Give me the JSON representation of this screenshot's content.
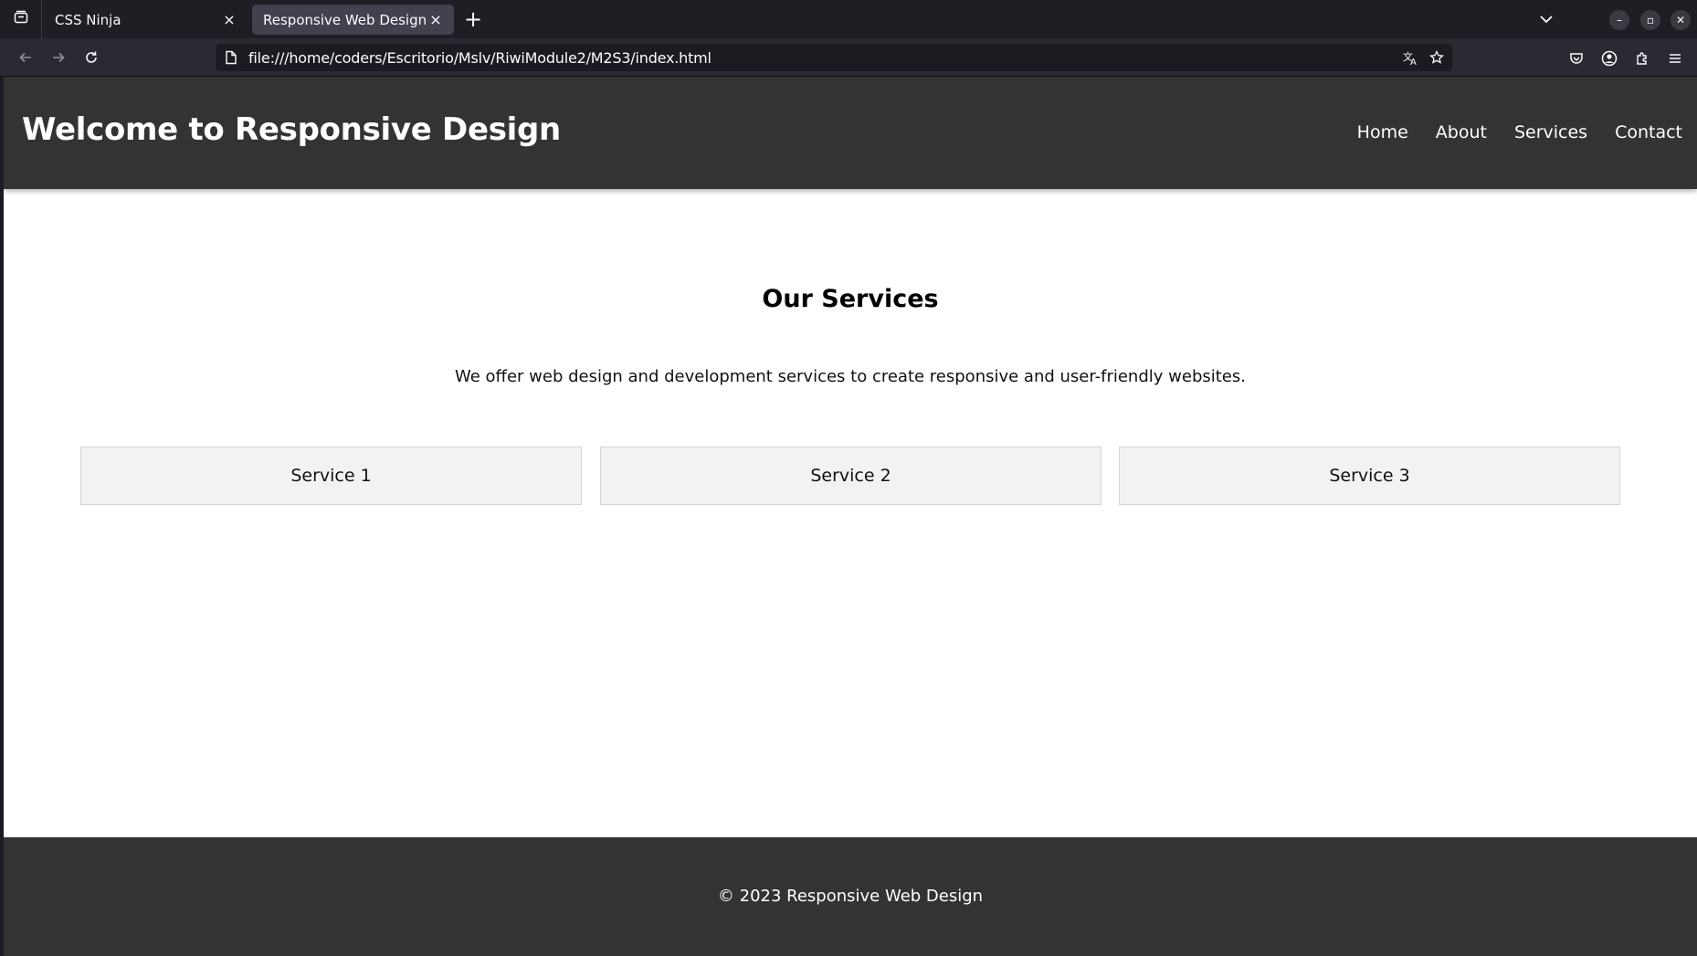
{
  "browser": {
    "tabs": [
      {
        "label": "CSS Ninja",
        "close": "×"
      },
      {
        "label": "Responsive Web Design",
        "close": "×"
      }
    ],
    "new_tab": "+",
    "window_controls": {
      "minimize": "–",
      "maximize": "▫",
      "close": "✕"
    },
    "url": "file:///home/coders/Escritorio/Mslv/RiwiModule2/M2S3/index.html",
    "icons": [
      "tab-list-icon",
      "back-arrow-icon",
      "forward-arrow-icon",
      "reload-icon",
      "page-icon",
      "translate-icon",
      "bookmark-star-icon",
      "pocket-icon",
      "account-icon",
      "extensions-icon",
      "menu-icon",
      "chevron-down-icon"
    ]
  },
  "site": {
    "title": "Welcome to Responsive Design",
    "nav": [
      "Home",
      "About",
      "Services",
      "Contact"
    ],
    "services": {
      "heading": "Our Services",
      "description": "We offer web design and development services to create responsive and user-friendly websites.",
      "items": [
        "Service 1",
        "Service 2",
        "Service 3"
      ]
    },
    "footer": "© 2023 Responsive Web Design"
  },
  "colors": {
    "header_bg": "#333333",
    "footer_bg": "#333333",
    "service_box_bg": "#f2f2f2",
    "chrome_bg": "#2b2a33"
  }
}
